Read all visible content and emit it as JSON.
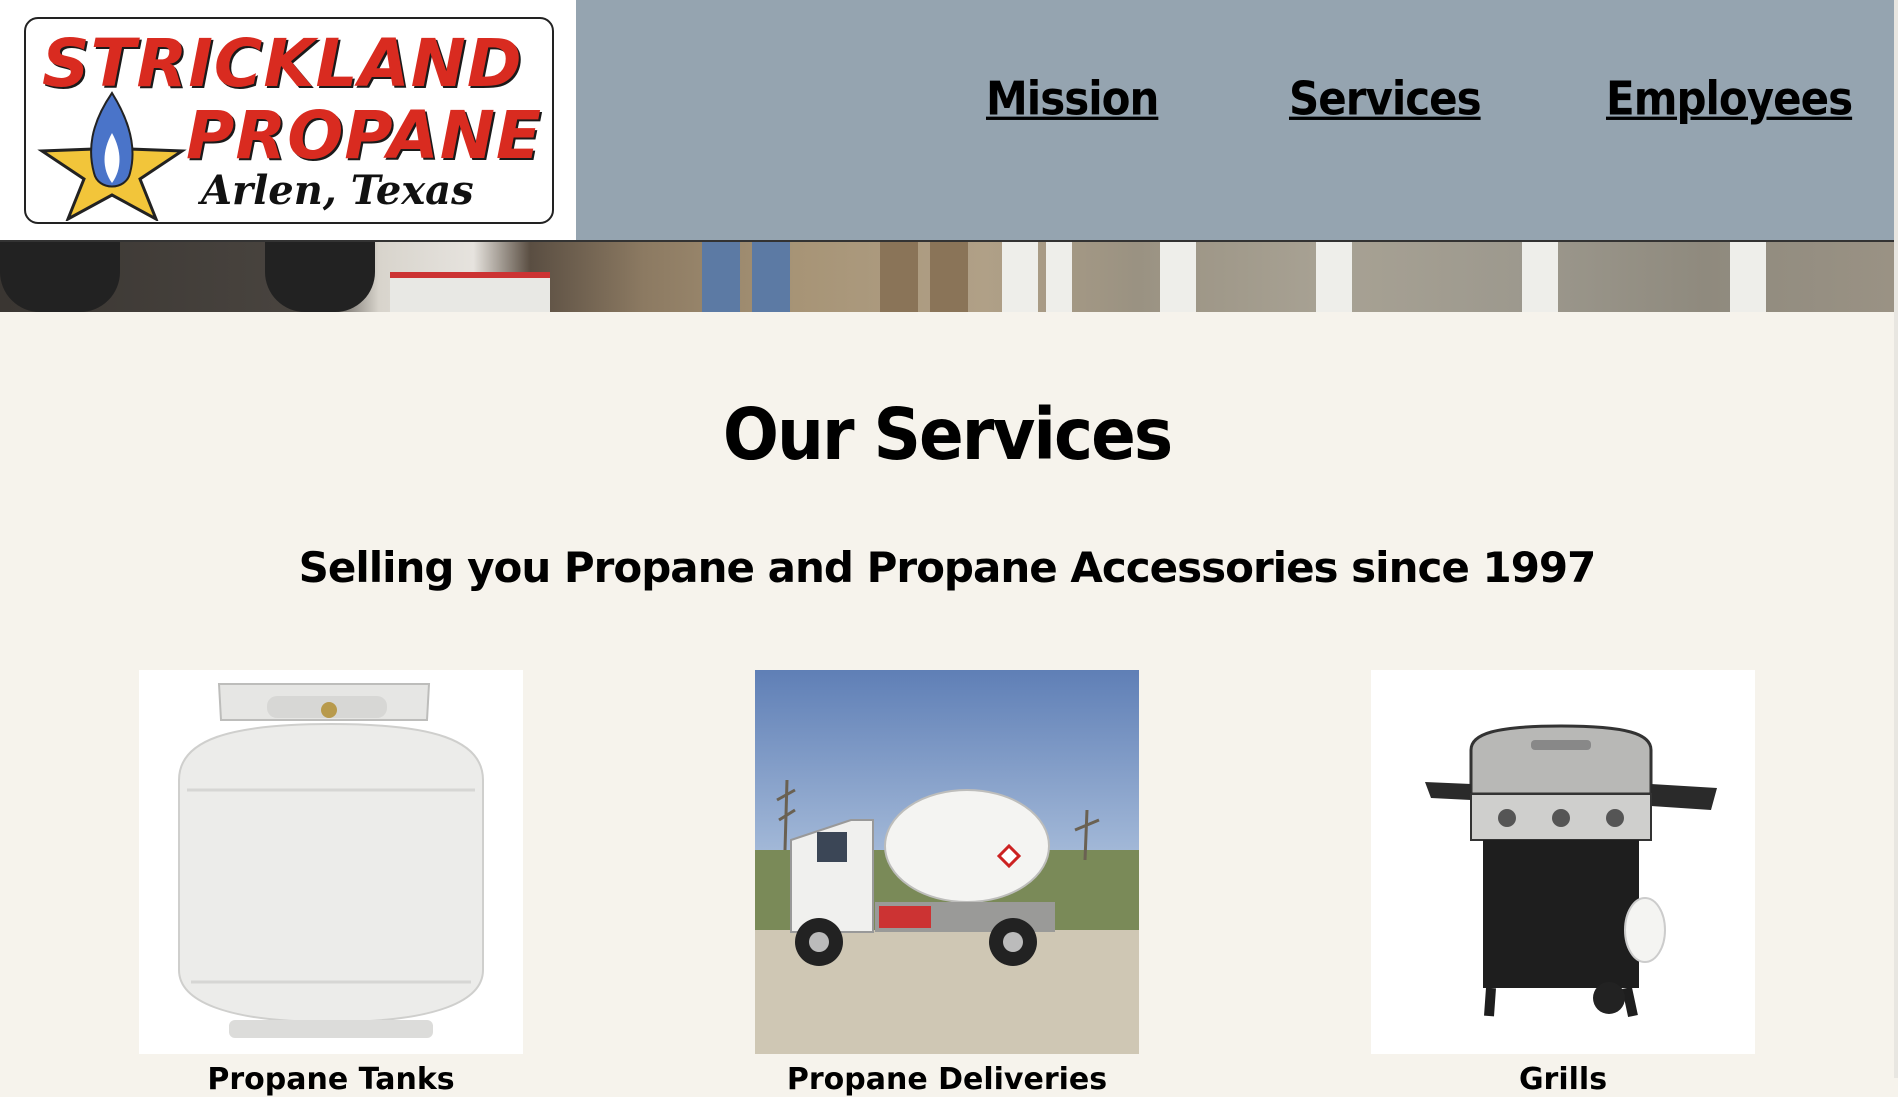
{
  "logo": {
    "line1": "STRICKLAND",
    "line2": "PROPANE",
    "line3": "Arlen, Texas"
  },
  "nav": {
    "items": [
      {
        "label": "Mission"
      },
      {
        "label": "Services"
      },
      {
        "label": "Employees"
      }
    ]
  },
  "main": {
    "title": "Our Services",
    "tagline": "Selling you Propane and Propane Accessories since 1997",
    "cards": [
      {
        "caption": "Propane Tanks",
        "image": "propane-tank"
      },
      {
        "caption": "Propane Deliveries",
        "image": "propane-truck"
      },
      {
        "caption": "Grills",
        "image": "gas-grill"
      }
    ]
  },
  "colors": {
    "header_bg": "#95a4b0",
    "page_bg": "#f6f3ec",
    "logo_red": "#d92b20",
    "flame_blue": "#4a74c9",
    "star_yellow": "#f2c53a"
  }
}
